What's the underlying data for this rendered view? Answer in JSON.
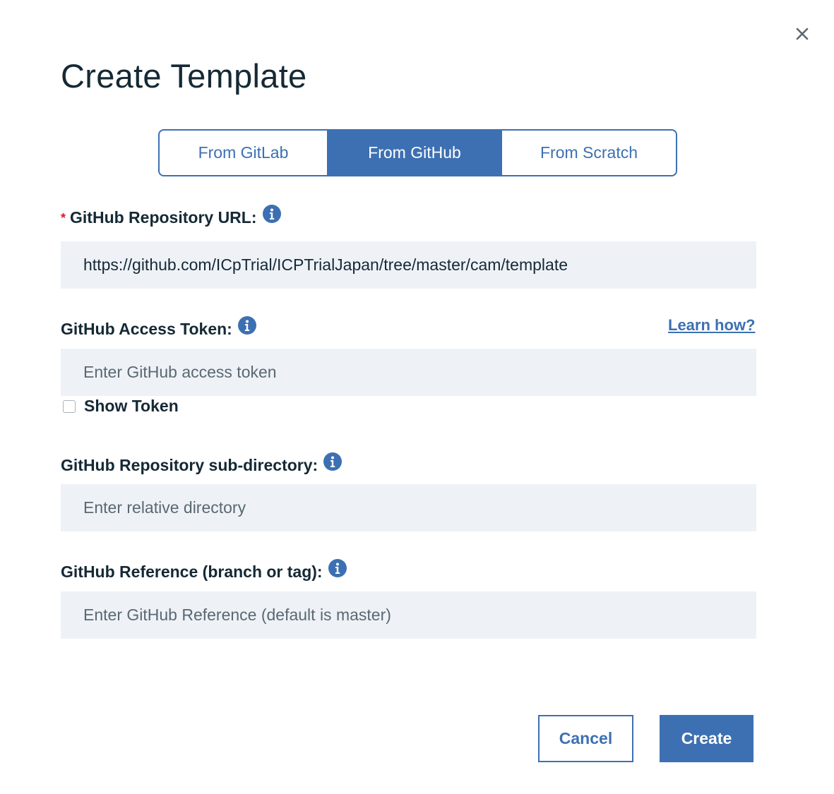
{
  "dialog": {
    "title": "Create Template",
    "close_icon": "close-icon"
  },
  "tabs": [
    {
      "label": "From GitLab",
      "selected": false
    },
    {
      "label": "From GitHub",
      "selected": true
    },
    {
      "label": "From Scratch",
      "selected": false
    }
  ],
  "form": {
    "repo_url": {
      "label": "GitHub Repository URL:",
      "required_marker": "*",
      "value": "https://github.com/ICpTrial/ICPTrialJapan/tree/master/cam/template"
    },
    "access_token": {
      "label": "GitHub Access Token:",
      "placeholder": "Enter GitHub access token",
      "learn_link": "Learn how?",
      "show_token_label": "Show Token",
      "show_token_checked": false
    },
    "sub_directory": {
      "label": "GitHub Repository sub-directory:",
      "placeholder": "Enter relative directory"
    },
    "reference": {
      "label": "GitHub Reference (branch or tag):",
      "placeholder": "Enter GitHub Reference (default is master)"
    }
  },
  "buttons": {
    "cancel": "Cancel",
    "create": "Create"
  },
  "colors": {
    "accent": "#3d70b2",
    "required": "#e0182d",
    "field_bg": "#eef2f7",
    "text": "#152935"
  }
}
